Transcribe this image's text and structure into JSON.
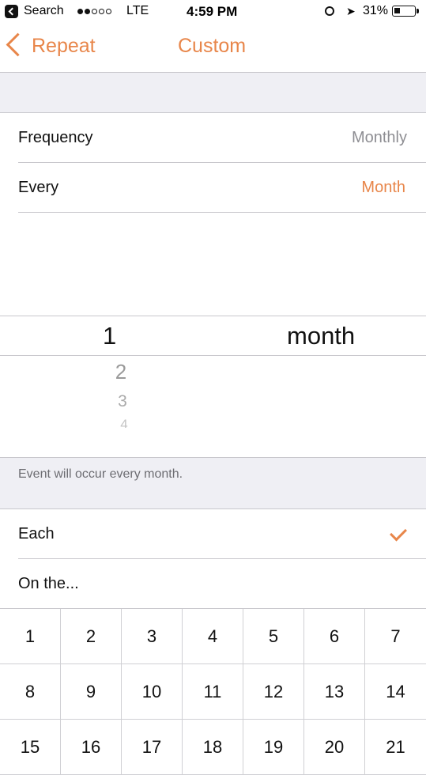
{
  "status_bar": {
    "back_app": "Search",
    "carrier": "LTE",
    "time": "4:59 PM",
    "battery": "31%",
    "battery_level": 0.31,
    "signal_bars_filled": 2,
    "signal_bars_total": 5
  },
  "nav": {
    "back_label": "Repeat",
    "title": "Custom"
  },
  "settings": {
    "frequency_label": "Frequency",
    "frequency_value": "Monthly",
    "every_label": "Every",
    "every_value": "Month"
  },
  "picker": {
    "selected_number": "1",
    "unit": "month",
    "next_numbers": [
      "2",
      "3",
      "4"
    ]
  },
  "note": "Event will occur every month.",
  "mode": {
    "each_label": "Each",
    "each_selected": true,
    "on_the_label": "On the..."
  },
  "calendar_days": [
    "1",
    "2",
    "3",
    "4",
    "5",
    "6",
    "7",
    "8",
    "9",
    "10",
    "11",
    "12",
    "13",
    "14",
    "15",
    "16",
    "17",
    "18",
    "19",
    "20",
    "21"
  ],
  "colors": {
    "accent": "#e8864a",
    "muted": "#8e8e93",
    "group_background": "#efeff4",
    "separator": "#c8c7cc"
  }
}
